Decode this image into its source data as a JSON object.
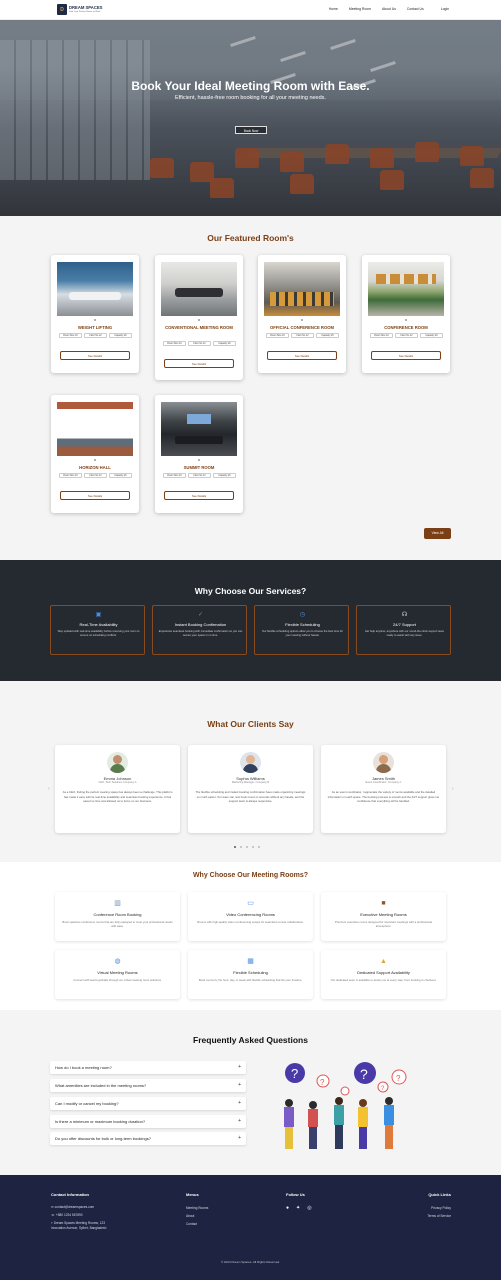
{
  "brand": {
    "name": "DREAM SPACES",
    "tagline": "Find Your Perfect Room to Work",
    "colors": {
      "accent": "#7a3f14",
      "dark": "#252a30",
      "footer": "#1d2340"
    }
  },
  "nav": {
    "items": [
      "Home",
      "Meeting Room",
      "About Us",
      "Contact Us"
    ],
    "login": "Login"
  },
  "hero": {
    "title": "Book Your Ideal Meeting Room with Ease.",
    "subtitle": "Efficient, hassle-free room booking for all your meeting needs.",
    "cta": "Book Now"
  },
  "featured": {
    "title": "Our Featured Room's",
    "rooms": [
      {
        "name": "WEIGHT LIFTING",
        "tags": [
          "Room Size 10",
          "Floor No 12",
          "Capacity 20"
        ],
        "button": "See Details"
      },
      {
        "name": "CONVENTIONAL MEETING ROOM",
        "tags": [
          "Room Size 10",
          "Floor No 12",
          "Capacity 20"
        ],
        "button": "See Details"
      },
      {
        "name": "OFFICIAL CONFERENCE ROOM",
        "tags": [
          "Room Size 10",
          "Floor No 12",
          "Capacity 20"
        ],
        "button": "See Details"
      },
      {
        "name": "CONFERENCE ROOM",
        "tags": [
          "Room Size 10",
          "Floor No 12",
          "Capacity 20"
        ],
        "button": "See Details"
      },
      {
        "name": "HORIZON HALL",
        "tags": [
          "Room Size 10",
          "Floor No 12",
          "Capacity 20"
        ],
        "button": "See Details"
      },
      {
        "name": "SUMMIT ROOM",
        "tags": [
          "Room Size 10",
          "Floor No 12",
          "Capacity 20"
        ],
        "button": "See Details"
      }
    ],
    "view_all": "View All"
  },
  "services": {
    "title": "Why Choose Our Services?",
    "items": [
      {
        "icon": "calendar-icon",
        "title": "Real-Time Availability",
        "desc": "Stay updated with real-time availability before reserving your room to ensure no scheduling conflicts."
      },
      {
        "icon": "check-icon",
        "title": "Instant Booking Confirmation",
        "desc": "Experience seamless booking with immediate confirmation so you can secure your space in no time."
      },
      {
        "icon": "clock-icon",
        "title": "Flexible Scheduling",
        "desc": "Our flexible scheduling options allow you to choose the best time for your meeting without hassle."
      },
      {
        "icon": "headset-icon",
        "title": "24/7 Support",
        "desc": "Get help anytime, anywhere with our round-the-clock support team ready to assist with any issue."
      }
    ]
  },
  "testimonials": {
    "title": "What Our Clients Say",
    "items": [
      {
        "name": "Emma Johnson",
        "role": "CEO, Tech Solutions Company A",
        "quote": "As a CEO, finding the perfect meeting space has always been a challenge. This platform has made it easy with its real-time availability and seamless booking experience. It has saved us time and allowed us to focus on our business."
      },
      {
        "name": "Sophia Williams",
        "role": "Marketing Manager, Company B",
        "quote": "The flexible scheduling and instant booking confirmation have made organizing meetings so much easier. Our team can now book rooms in seconds without any hassle, and the support team is always responsive."
      },
      {
        "name": "James Smith",
        "role": "Event Coordinator, Company C",
        "quote": "As an event coordinator, I appreciate the variety of rooms available and the detailed information on each space. The booking process is smooth and the 24/7 support gives me confidence that everything will be handled."
      }
    ]
  },
  "meeting_rooms": {
    "title": "Why Choose Our Meeting Rooms?",
    "items": [
      {
        "icon": "building-icon",
        "title": "Conference Room Booking",
        "desc": "Book spacious conference rooms that are fully equipped to meet your professional needs with ease."
      },
      {
        "icon": "video-icon",
        "title": "Video Conferencing Rooms",
        "desc": "Rooms with high-quality video conferencing setups for seamless remote collaboration."
      },
      {
        "icon": "briefcase-icon",
        "title": "Executive Meeting Rooms",
        "desc": "Premium executive rooms designed for important meetings with a professional atmosphere."
      },
      {
        "icon": "globe-icon",
        "title": "Virtual Meeting Rooms",
        "desc": "Connect with teams globally through our virtual meeting room solutions."
      },
      {
        "icon": "calendar-icon",
        "title": "Flexible Scheduling",
        "desc": "Book rooms by the hour, day, or week with flexible scheduling that fits your timeline."
      },
      {
        "icon": "lock-icon",
        "title": "Dedicated Support Availability",
        "desc": "Our dedicated team is available to assist you at every step, from booking to checkout."
      }
    ]
  },
  "faq": {
    "title": "Frequently Asked Questions",
    "questions": [
      "How do I book a meeting room?",
      "What amenities are included in the meeting rooms?",
      "Can I modify or cancel my booking?",
      "Is there a minimum or maximum booking duration?",
      "Do you offer discounts for bulk or long-term bookings?"
    ]
  },
  "footer": {
    "contact_title": "Contact Information",
    "email": "contact@dreamspaces.com",
    "phone": "+880 1234 567890",
    "address": "Dream Spaces Meeting Rooms, 123 Innovation Avenue, Sylhet, Bangladesh",
    "menu_title": "Menus",
    "menu": [
      "Meeting Rooms",
      "About",
      "Contact"
    ],
    "follow_title": "Follow Us",
    "quick_title": "Quick Links",
    "quick": [
      "Privacy Policy",
      "Terms of Service"
    ],
    "copyright": "© 2024 Dream Spaces. All Rights Reserved."
  }
}
